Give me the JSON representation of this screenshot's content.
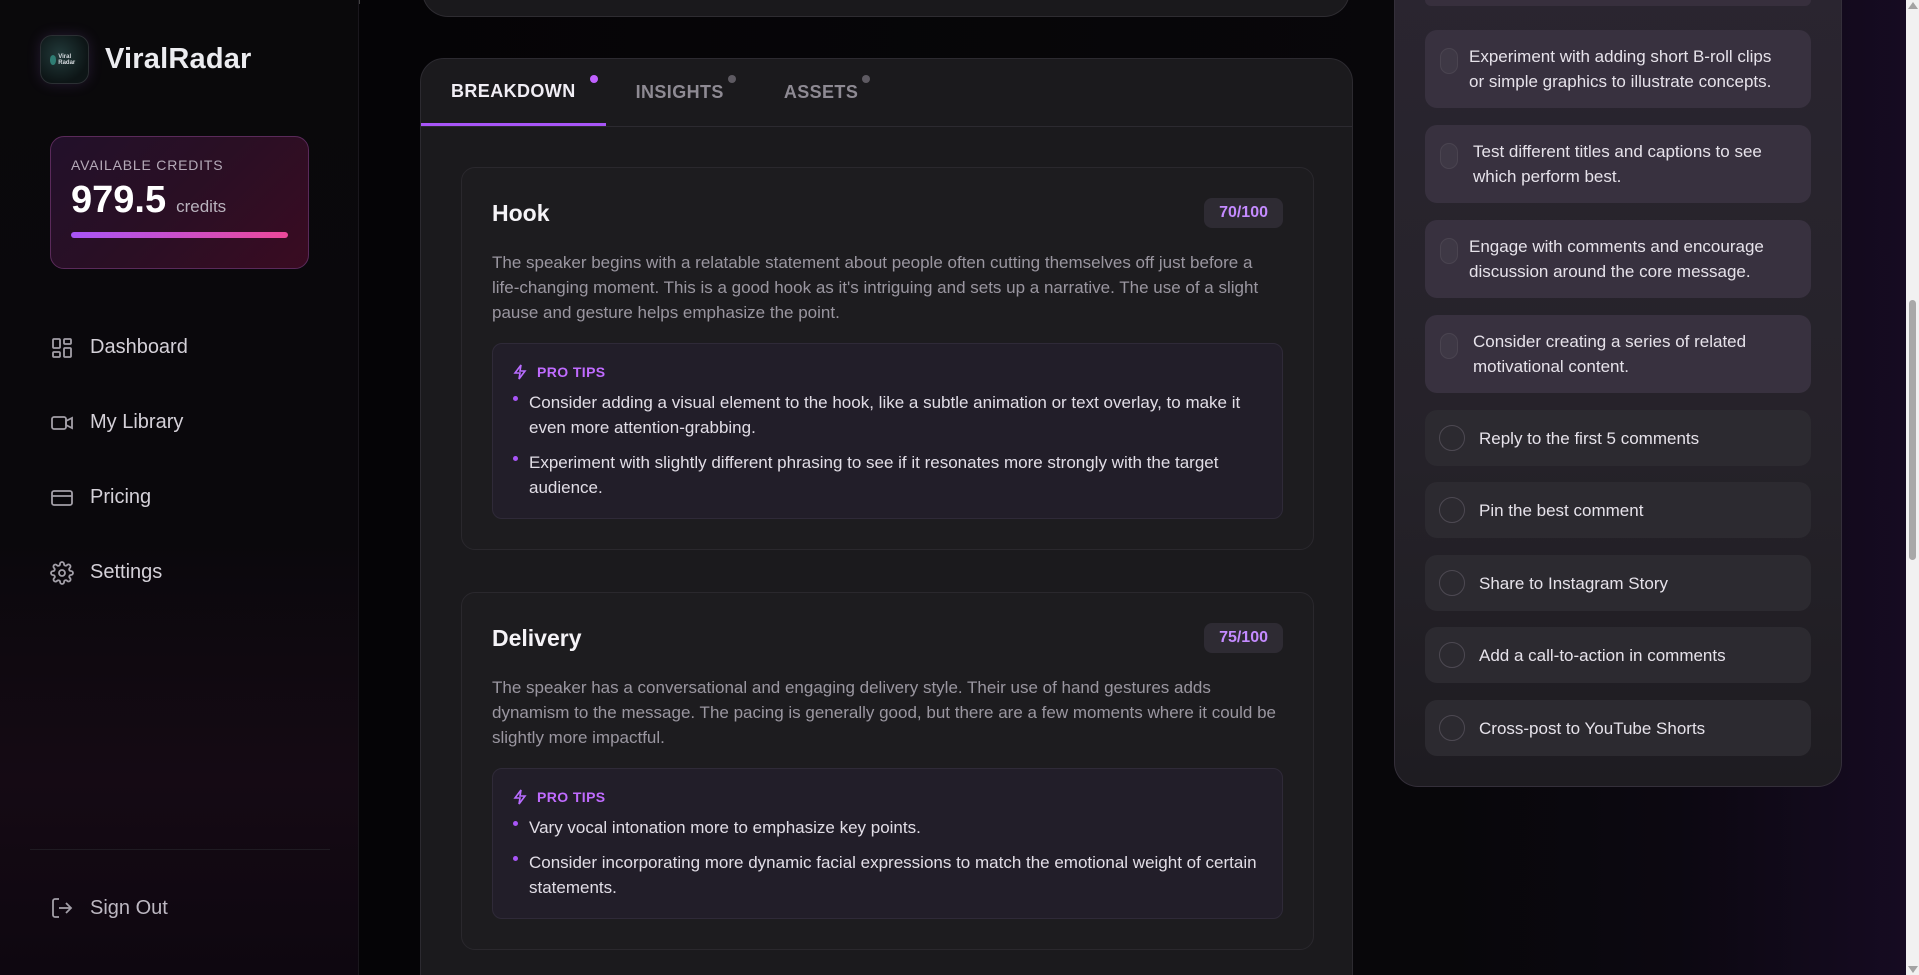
{
  "brand": {
    "name": "ViralRadar",
    "mark_text": "Viral Radar"
  },
  "credits": {
    "label": "AVAILABLE CREDITS",
    "value": "979.5",
    "unit": "credits",
    "fill_fraction": 1.0
  },
  "nav": {
    "items": [
      {
        "label": "Dashboard",
        "icon": "dashboard-icon"
      },
      {
        "label": "My Library",
        "icon": "video-icon"
      },
      {
        "label": "Pricing",
        "icon": "credit-card-icon"
      },
      {
        "label": "Settings",
        "icon": "gear-icon"
      }
    ],
    "sign_out": "Sign Out"
  },
  "tabs": [
    {
      "label": "BREAKDOWN",
      "active": true
    },
    {
      "label": "INSIGHTS",
      "active": false
    },
    {
      "label": "ASSETS",
      "active": false
    }
  ],
  "cards": [
    {
      "title": "Hook",
      "score": "70/100",
      "body": "The speaker begins with a relatable statement about people often cutting themselves off just before a life-changing moment. This is a good hook as it's intriguing and sets up a narrative. The use of a slight pause and gesture helps emphasize the point.",
      "tips_label": "PRO TIPS",
      "tips": [
        "Consider adding a visual element to the hook, like a subtle animation or text overlay, to make it even more attention-grabbing.",
        "Experiment with slightly different phrasing to see if it resonates more strongly with the target audience."
      ]
    },
    {
      "title": "Delivery",
      "score": "75/100",
      "body": "The speaker has a conversational and engaging delivery style. Their use of hand gestures adds dynamism to the message. The pacing is generally good, but there are a few moments where it could be slightly more impactful.",
      "tips_label": "PRO TIPS",
      "tips": [
        "Vary vocal intonation more to emphasize key points.",
        "Consider incorporating more dynamic facial expressions to match the emotional weight of certain statements."
      ]
    }
  ],
  "checklist": [
    {
      "text": "Experiment with adding short B-roll clips or simple graphics to illustrate concepts.",
      "checked": false
    },
    {
      "text": "Test different titles and captions to see which perform best.",
      "checked": false
    },
    {
      "text": "Engage with comments and encourage discussion around the core message.",
      "checked": false
    },
    {
      "text": "Consider creating a series of related motivational content.",
      "checked": false
    },
    {
      "text": "Reply to the first 5 comments",
      "checked": false
    },
    {
      "text": "Pin the best comment",
      "checked": false
    },
    {
      "text": "Share to Instagram Story",
      "checked": false
    },
    {
      "text": "Add a call-to-action in comments",
      "checked": false
    },
    {
      "text": "Cross-post to YouTube Shorts",
      "checked": false
    }
  ],
  "colors": {
    "accent": "#a855f7",
    "accent_pink": "#ec4899",
    "background": "#050406"
  }
}
